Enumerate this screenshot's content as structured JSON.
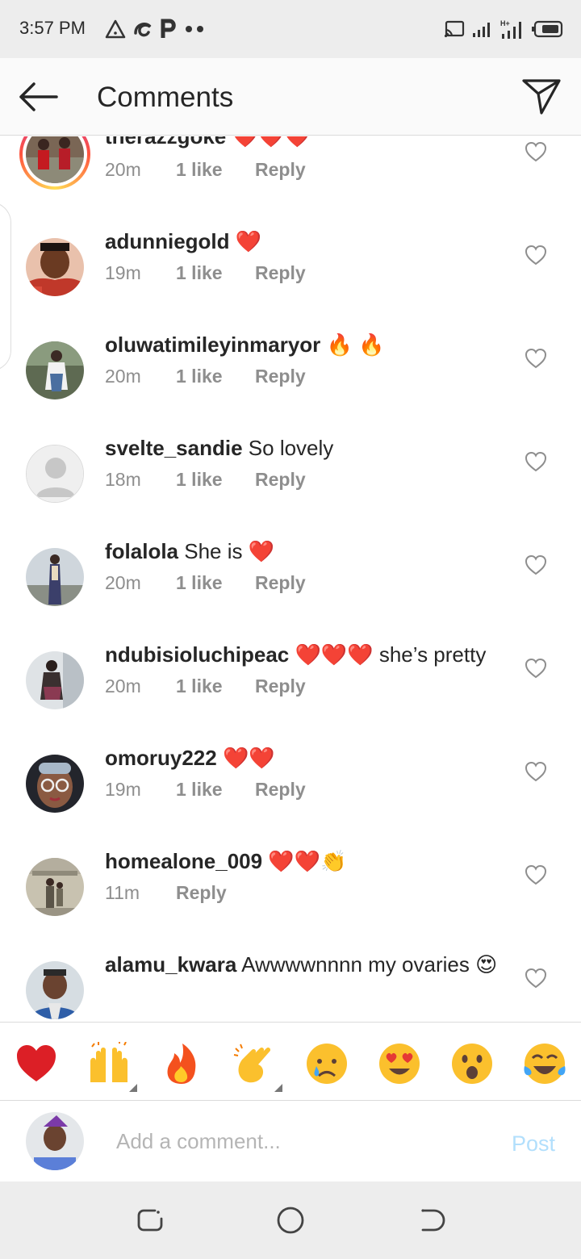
{
  "status_bar": {
    "time": "3:57 PM",
    "left_icons": [
      "warning-triangle-icon",
      "sync-swirl-icon",
      "p-app-icon",
      "more-dots-icon"
    ],
    "right_icons": [
      "cast-icon",
      "signal-icon",
      "signal-h-plus-icon",
      "battery-icon"
    ]
  },
  "header": {
    "title": "Comments",
    "back_icon": "arrow-left-icon",
    "share_icon": "paper-plane-icon"
  },
  "comments": [
    {
      "username": "therazzgoke",
      "text": "",
      "emoji": "❤️❤️❤️",
      "time": "20m",
      "likes": "1 like",
      "reply": "Reply",
      "story": true
    },
    {
      "username": "adunniegold",
      "text": "",
      "emoji": "❤️",
      "time": "19m",
      "likes": "1 like",
      "reply": "Reply"
    },
    {
      "username": "oluwatimileyinmaryor",
      "text": "",
      "emoji": "🔥 🔥",
      "time": "20m",
      "likes": "1 like",
      "reply": "Reply"
    },
    {
      "username": "svelte_sandie",
      "text": "So lovely",
      "emoji": "",
      "time": "18m",
      "likes": "1 like",
      "reply": "Reply"
    },
    {
      "username": "folalola",
      "text": "She is",
      "emoji": "❤️",
      "time": "20m",
      "likes": "1 like",
      "reply": "Reply"
    },
    {
      "username": "ndubisioluchipeac",
      "text": "",
      "emoji": "❤️❤️❤️",
      "text_after": "she’s pretty",
      "time": "20m",
      "likes": "1 like",
      "reply": "Reply"
    },
    {
      "username": "omoruy222",
      "text": "",
      "emoji": "❤️❤️",
      "time": "19m",
      "likes": "1 like",
      "reply": "Reply"
    },
    {
      "username": "homealone_009",
      "text": "",
      "emoji": "❤️❤️👏",
      "time": "11m",
      "likes": "",
      "reply": "Reply"
    },
    {
      "username": "alamu_kwara",
      "text": "Awwwwnnnn my ovaries",
      "emoji": "😍",
      "time": "",
      "likes": "",
      "reply": ""
    }
  ],
  "emoji_bar": [
    "❤️",
    "🙌",
    "🔥",
    "👏",
    "😢",
    "😍",
    "😮",
    "😂"
  ],
  "composer": {
    "placeholder": "Add a comment...",
    "post_label": "Post"
  },
  "nav_bar": [
    "recents-icon",
    "home-circle-icon",
    "back-nav-icon"
  ],
  "colors": {
    "accent_post": "#b2dffc",
    "meta_gray": "#8e8e8e",
    "text": "#262626",
    "bar_bg": "#ededed"
  }
}
